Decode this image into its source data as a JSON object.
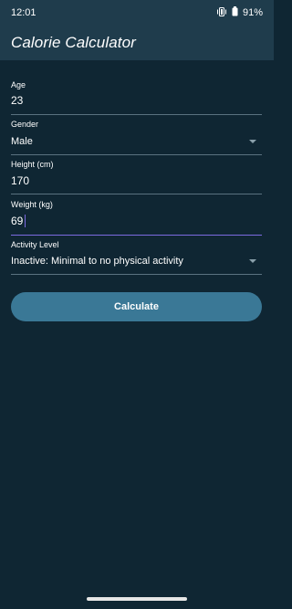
{
  "status_bar": {
    "time": "12:01",
    "battery": "91%",
    "icons": [
      "vibrate-icon",
      "battery-icon"
    ]
  },
  "app_bar": {
    "title": "Calorie Calculator"
  },
  "form": {
    "age": {
      "label": "Age",
      "value": "23"
    },
    "gender": {
      "label": "Gender",
      "value": "Male"
    },
    "height": {
      "label": "Height (cm)",
      "value": "170"
    },
    "weight": {
      "label": "Weight (kg)",
      "value": "69"
    },
    "activity": {
      "label": "Activity Level",
      "value": "Inactive: Minimal to no physical activity"
    }
  },
  "button": {
    "label": "Calculate"
  },
  "colors": {
    "app_bar": "#1f3c4c",
    "background": "#0f2633",
    "button": "#3a7896",
    "focus": "#7c6ae0"
  }
}
